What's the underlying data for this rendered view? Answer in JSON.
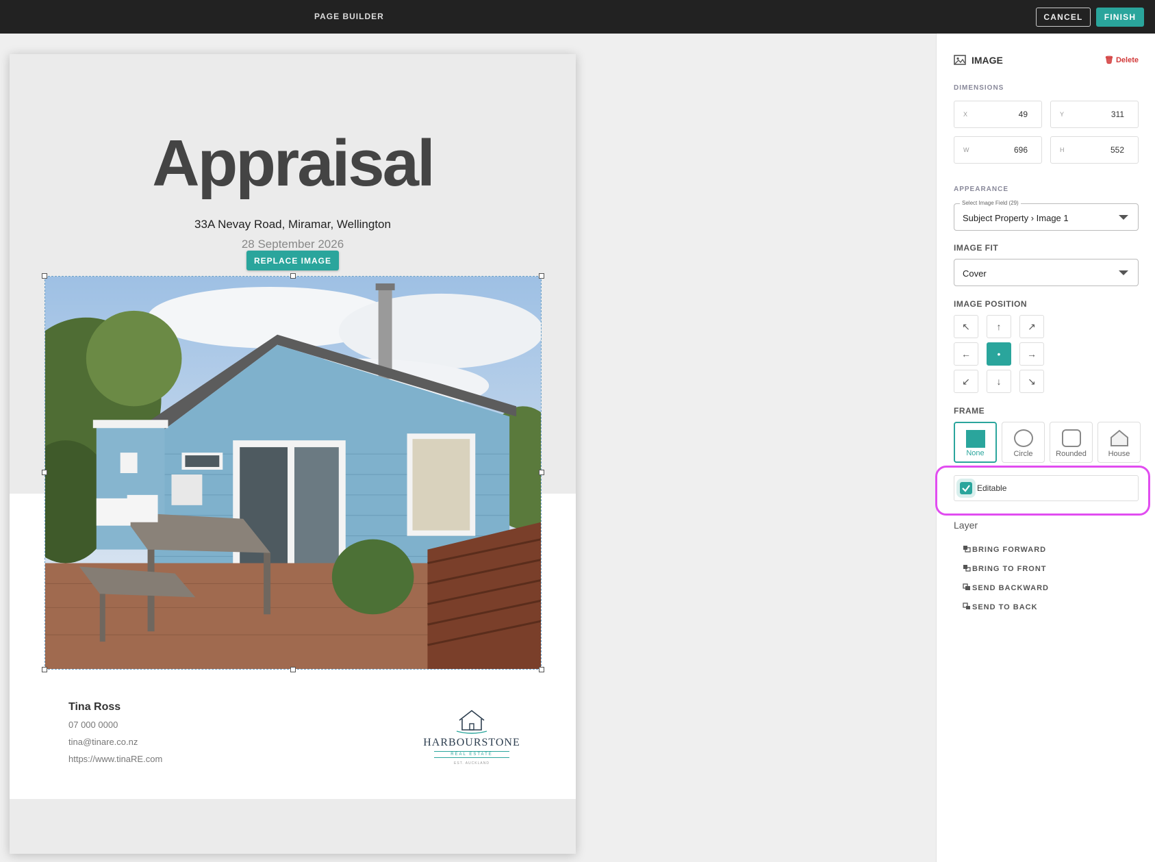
{
  "app": {
    "title": "PAGE BUILDER",
    "cancel_label": "CANCEL",
    "finish_label": "FINISH"
  },
  "page": {
    "heading": "Appraisal",
    "address": "33A Nevay Road, Miramar, Wellington",
    "date": "28 September 2026",
    "replace_image_label": "REPLACE IMAGE",
    "agent": {
      "name": "Tina Ross",
      "phone": "07 000 0000",
      "email": "tina@tinare.co.nz",
      "website": "https://www.tinaRE.com"
    },
    "logo": {
      "brand": "HARBOURSTONE",
      "tagline": "REAL ESTATE",
      "est": "EST. AUCKLAND"
    }
  },
  "panel": {
    "title": "IMAGE",
    "delete_label": "Delete",
    "dimensions_label": "DIMENSIONS",
    "dimensions": {
      "x_label": "X",
      "x": "49",
      "y_label": "Y",
      "y": "311",
      "w_label": "W",
      "w": "696",
      "h_label": "H",
      "h": "552"
    },
    "appearance_label": "APPEARANCE",
    "image_field": {
      "legend": "Select Image Field (29)",
      "value": "Subject Property › Image 1"
    },
    "image_fit_label": "IMAGE FIT",
    "image_fit_value": "Cover",
    "image_position_label": "IMAGE POSITION",
    "positions": [
      "↖",
      "↑",
      "↗",
      "←",
      "•",
      "→",
      "↙",
      "↓",
      "↘"
    ],
    "frame_label": "FRAME",
    "frames": [
      "None",
      "Circle",
      "Rounded",
      "House"
    ],
    "editable_label": "Editable",
    "layer_label": "Layer",
    "layer_actions": [
      "BRING FORWARD",
      "BRING TO FRONT",
      "SEND BACKWARD",
      "SEND TO BACK"
    ]
  },
  "colors": {
    "accent": "#2aa59c",
    "topbar": "#222222",
    "highlight": "#e14df0",
    "delete": "#d23a3a"
  }
}
